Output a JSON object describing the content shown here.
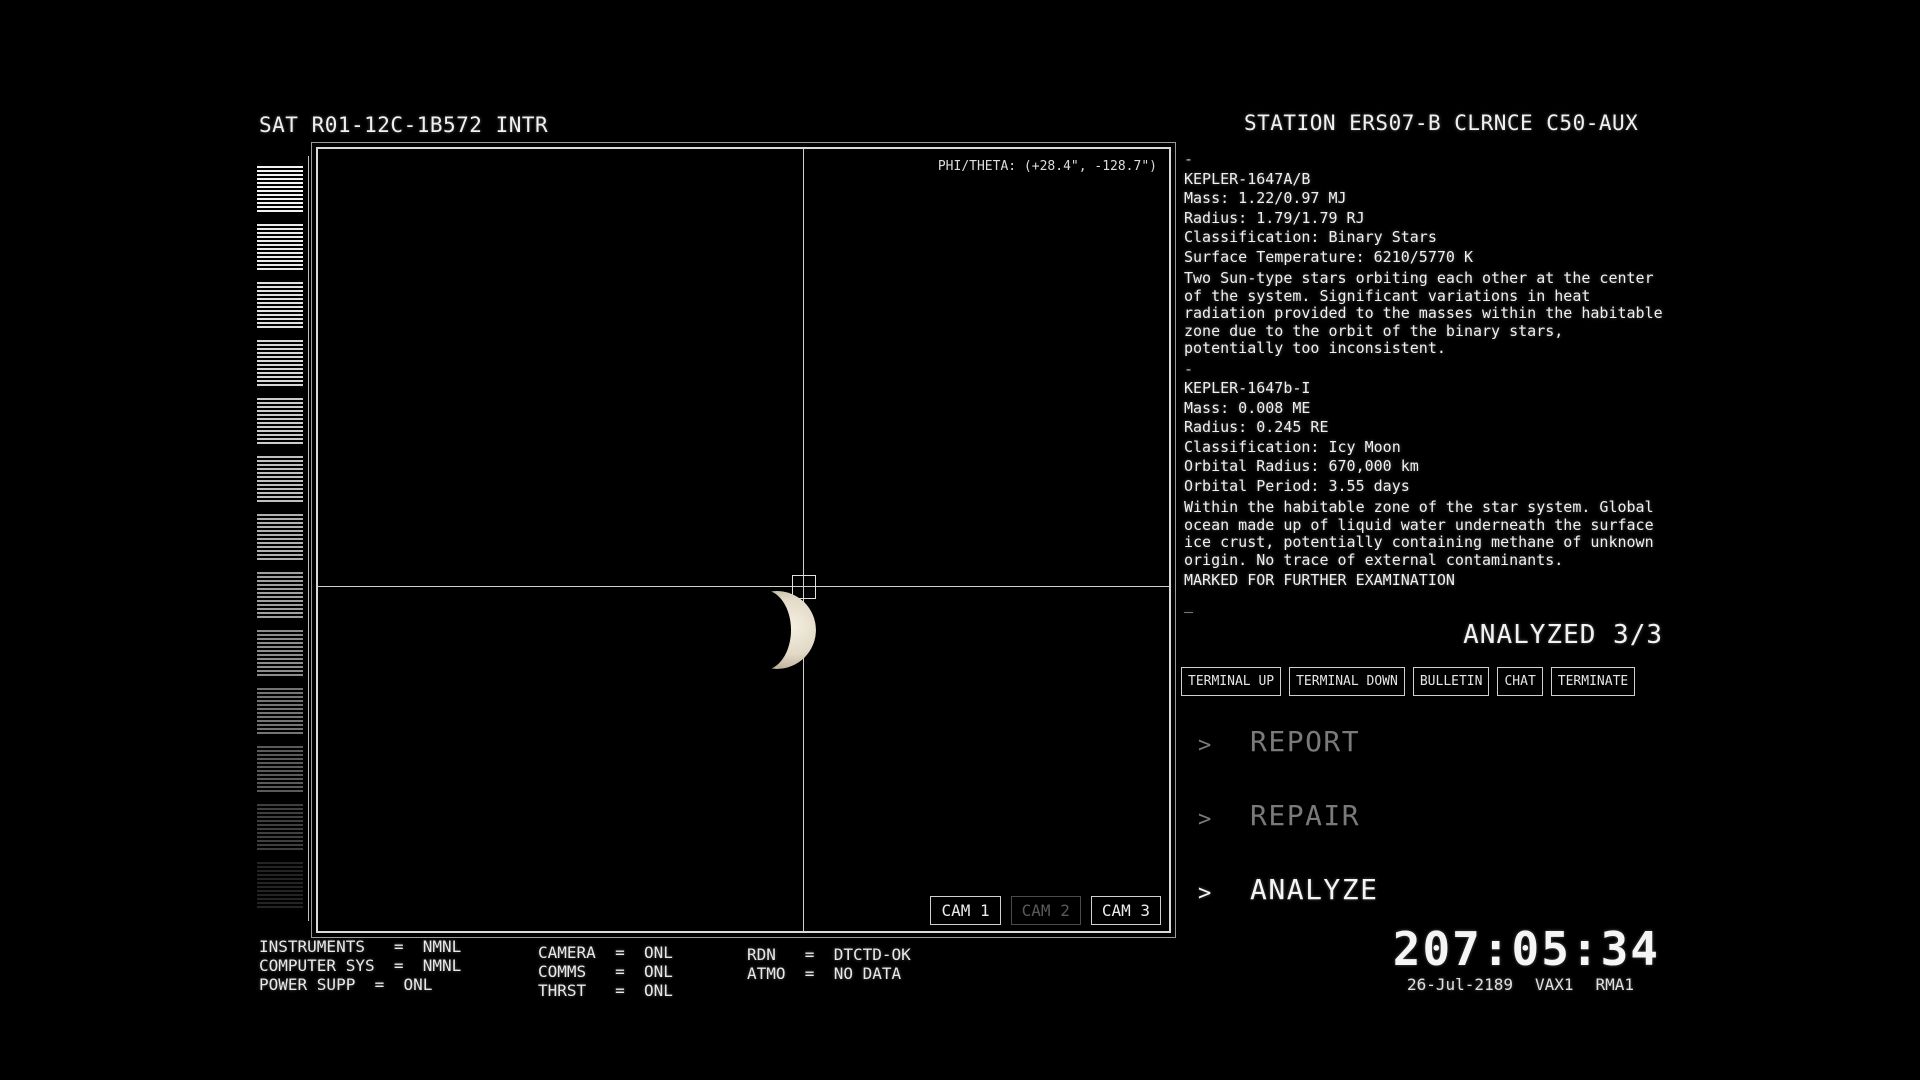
{
  "header": {
    "sat_id": "SAT R01-12C-1B572 INTR",
    "station": "STATION ERS07-B CLRNCE C50-AUX"
  },
  "viewport": {
    "phi_theta": "PHI/THETA: (+28.4\", -128.7\")",
    "cams": [
      {
        "label": "CAM 1",
        "state": "active"
      },
      {
        "label": "CAM 2",
        "state": "disabled"
      },
      {
        "label": "CAM 3",
        "state": "active"
      }
    ]
  },
  "status": {
    "col1": [
      "INSTRUMENTS   =  NMNL",
      "COMPUTER SYS  =  NMNL",
      "POWER SUPP  =  ONL"
    ],
    "col2": [
      "CAMERA  =  ONL",
      "COMMS   =  ONL",
      "THRST   =  ONL"
    ],
    "col3": [
      "RDN   =  DTCTD-OK",
      "ATMO  =  NO DATA"
    ]
  },
  "info": {
    "top_dash": "-",
    "star": {
      "name": "KEPLER-1647A/B",
      "mass": "Mass: 1.22/0.97 MJ",
      "radius": "Radius: 1.79/1.79 RJ",
      "classification": "Classification: Binary Stars",
      "temperature": "Surface Temperature: 6210/5770 K",
      "description": "Two Sun-type stars orbiting each other at the center of the system. Significant variations in heat radiation provided to the masses within the habitable zone due to the orbit of the binary stars, potentially too inconsistent."
    },
    "mid_dash": "-",
    "moon": {
      "name": "KEPLER-1647b-I",
      "mass": "Mass: 0.008 ME",
      "radius": "Radius: 0.245 RE",
      "classification": "Classification: Icy Moon",
      "orbital_radius": "Orbital Radius: 670,000 km",
      "orbital_period": "Orbital Period: 3.55 days",
      "description": "Within the habitable zone of the star system. Global ocean made up of liquid water underneath the surface ice crust, potentially containing methane of unknown origin. No trace of external contaminants.",
      "mark": "MARKED FOR FURTHER EXAMINATION"
    },
    "end_dash": "_"
  },
  "analyzed": "ANALYZED 3/3",
  "terminal_buttons": [
    "TERMINAL UP",
    "TERMINAL DOWN",
    "BULLETIN",
    "CHAT",
    "TERMINATE"
  ],
  "menu": [
    {
      "chevron": ">",
      "label": "REPORT",
      "state": "dim"
    },
    {
      "chevron": ">",
      "label": "REPAIR",
      "state": "dim"
    },
    {
      "chevron": ">",
      "label": "ANALYZE",
      "state": "active"
    }
  ],
  "clock": {
    "time": "207:05:34",
    "date": "26-Jul-2189",
    "code1": "VAX1",
    "code2": "RMA1"
  },
  "colors": {
    "background": "#000000",
    "foreground": "#e6e6e6",
    "dim": "#7a7a7a"
  }
}
